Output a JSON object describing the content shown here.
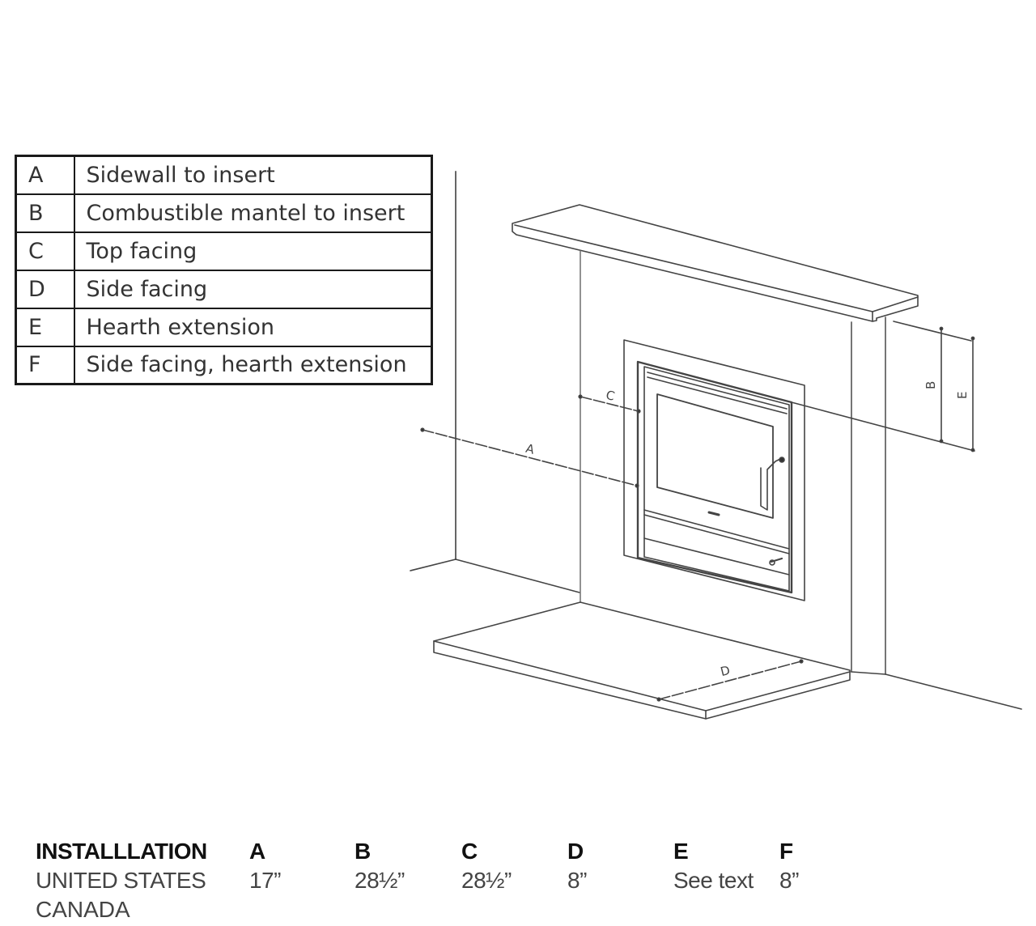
{
  "legend": [
    {
      "key": "A",
      "description": "Sidewall to insert"
    },
    {
      "key": "B",
      "description": "Combustible mantel to insert"
    },
    {
      "key": "C",
      "description": "Top facing"
    },
    {
      "key": "D",
      "description": "Side facing"
    },
    {
      "key": "E",
      "description": "Hearth extension"
    },
    {
      "key": "F",
      "description": "Side facing, hearth extension"
    }
  ],
  "diagram": {
    "subject": "fireplace insert installation clearances",
    "dimension_labels": {
      "A": "A",
      "B": "B",
      "C": "C",
      "D": "D",
      "E": "E"
    },
    "line_color": "#444444"
  },
  "spec_table": {
    "header": {
      "label": "INSTALLLATION",
      "cols": [
        "A",
        "B",
        "C",
        "D",
        "E",
        "F"
      ]
    },
    "rows": [
      {
        "label": "UNITED STATES",
        "values": [
          "17”",
          "28½”",
          "28½”",
          "8”",
          "See text",
          "8”"
        ]
      },
      {
        "label": "CANADA",
        "values": [
          "",
          "",
          "",
          "",
          "",
          ""
        ]
      }
    ]
  }
}
